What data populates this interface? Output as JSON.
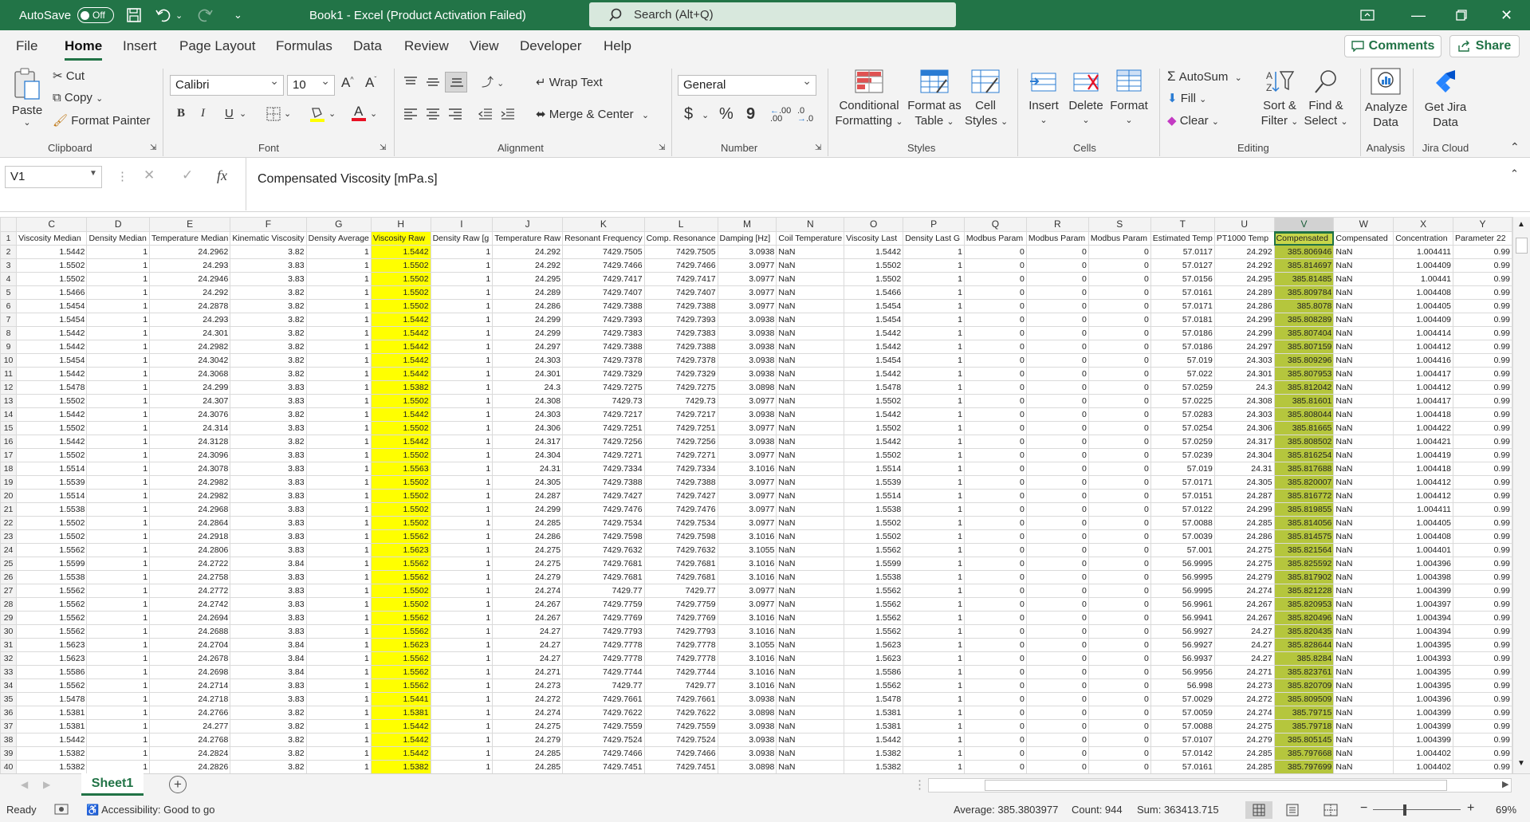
{
  "titlebar": {
    "autosave_label": "AutoSave",
    "autosave_state": "Off",
    "title": "Book1  -  Excel (Product Activation Failed)",
    "search_placeholder": "Search (Alt+Q)"
  },
  "menu": {
    "tabs": [
      "File",
      "Home",
      "Insert",
      "Page Layout",
      "Formulas",
      "Data",
      "Review",
      "View",
      "Developer",
      "Help"
    ],
    "active": "Home",
    "comments_label": "Comments",
    "share_label": "Share"
  },
  "ribbon": {
    "clipboard": {
      "paste": "Paste",
      "cut": "Cut",
      "copy": "Copy",
      "format_painter": "Format Painter",
      "group": "Clipboard"
    },
    "font": {
      "name": "Calibri",
      "size": "10",
      "group": "Font",
      "bold": "B",
      "italic": "I",
      "underline": "U",
      "grow": "A^",
      "shrink": "Aˇ"
    },
    "alignment": {
      "wrap": "Wrap Text",
      "merge": "Merge & Center",
      "group": "Alignment"
    },
    "number": {
      "format": "General",
      "currency": "$",
      "percent": "%",
      "comma": "9",
      "inc_decimal": ".00",
      "dec_decimal": ".0",
      "group": "Number"
    },
    "styles": {
      "conditional_1": "Conditional",
      "conditional_2": "Formatting",
      "format_table_1": "Format as",
      "format_table_2": "Table",
      "cell_styles_1": "Cell",
      "cell_styles_2": "Styles",
      "group": "Styles"
    },
    "cells": {
      "insert": "Insert",
      "delete": "Delete",
      "format": "Format",
      "group": "Cells"
    },
    "editing": {
      "autosum": "AutoSum",
      "fill": "Fill",
      "clear": "Clear",
      "sort_1": "Sort &",
      "sort_2": "Filter",
      "find_1": "Find &",
      "find_2": "Select",
      "group": "Editing"
    },
    "analysis": {
      "analyze_1": "Analyze",
      "analyze_2": "Data",
      "group": "Analysis"
    },
    "jira": {
      "jira_1": "Get Jira",
      "jira_2": "Data",
      "group": "Jira Cloud"
    }
  },
  "formula_bar": {
    "name_box": "V1",
    "content": "Compensated Viscosity [mPa.s]",
    "cancel": "✕",
    "enter": "✓",
    "fx": "fx"
  },
  "grid": {
    "columns": [
      "C",
      "D",
      "E",
      "F",
      "G",
      "H",
      "I",
      "J",
      "K",
      "L",
      "M",
      "N",
      "O",
      "P",
      "Q",
      "R",
      "S",
      "T",
      "U",
      "V",
      "W",
      "X",
      "Y"
    ],
    "selected_column": "V",
    "highlight_column": "H",
    "headers": [
      "Viscosity Median",
      "Density Median",
      "Temperature Median",
      "Kinematic Viscosity",
      "Density Average",
      "Viscosity Raw",
      "Density Raw [g",
      "Temperature Raw",
      "Resonant Frequency",
      "Comp. Resonance",
      "Damping [Hz]",
      "Coil Temperature",
      "Viscosity Last",
      "Density Last G",
      "Modbus Param",
      "Modbus Param",
      "Modbus Param",
      "Estimated Temp",
      "PT1000 Temp",
      "Compensated",
      "Compensated",
      "Concentration",
      "Parameter 22"
    ],
    "rows": [
      [
        "1.5442",
        "1",
        "24.2962",
        "3.82",
        "1",
        "1.5442",
        "1",
        "24.292",
        "7429.7505",
        "7429.7505",
        "3.0938",
        "NaN",
        "1.5442",
        "1",
        "0",
        "0",
        "0",
        "57.0117",
        "24.292",
        "385.806946",
        "NaN",
        "1.004411",
        "0.99"
      ],
      [
        "1.5502",
        "1",
        "24.293",
        "3.83",
        "1",
        "1.5502",
        "1",
        "24.292",
        "7429.7466",
        "7429.7466",
        "3.0977",
        "NaN",
        "1.5502",
        "1",
        "0",
        "0",
        "0",
        "57.0127",
        "24.292",
        "385.814697",
        "NaN",
        "1.004409",
        "0.99"
      ],
      [
        "1.5502",
        "1",
        "24.2946",
        "3.83",
        "1",
        "1.5502",
        "1",
        "24.295",
        "7429.7417",
        "7429.7417",
        "3.0977",
        "NaN",
        "1.5502",
        "1",
        "0",
        "0",
        "0",
        "57.0156",
        "24.295",
        "385.81485",
        "NaN",
        "1.00441",
        "0.99"
      ],
      [
        "1.5466",
        "1",
        "24.292",
        "3.82",
        "1",
        "1.5502",
        "1",
        "24.289",
        "7429.7407",
        "7429.7407",
        "3.0977",
        "NaN",
        "1.5466",
        "1",
        "0",
        "0",
        "0",
        "57.0161",
        "24.289",
        "385.809784",
        "NaN",
        "1.004408",
        "0.99"
      ],
      [
        "1.5454",
        "1",
        "24.2878",
        "3.82",
        "1",
        "1.5502",
        "1",
        "24.286",
        "7429.7388",
        "7429.7388",
        "3.0977",
        "NaN",
        "1.5454",
        "1",
        "0",
        "0",
        "0",
        "57.0171",
        "24.286",
        "385.8078",
        "NaN",
        "1.004405",
        "0.99"
      ],
      [
        "1.5454",
        "1",
        "24.293",
        "3.82",
        "1",
        "1.5442",
        "1",
        "24.299",
        "7429.7393",
        "7429.7393",
        "3.0938",
        "NaN",
        "1.5454",
        "1",
        "0",
        "0",
        "0",
        "57.0181",
        "24.299",
        "385.808289",
        "NaN",
        "1.004409",
        "0.99"
      ],
      [
        "1.5442",
        "1",
        "24.301",
        "3.82",
        "1",
        "1.5442",
        "1",
        "24.299",
        "7429.7383",
        "7429.7383",
        "3.0938",
        "NaN",
        "1.5442",
        "1",
        "0",
        "0",
        "0",
        "57.0186",
        "24.299",
        "385.807404",
        "NaN",
        "1.004414",
        "0.99"
      ],
      [
        "1.5442",
        "1",
        "24.2982",
        "3.82",
        "1",
        "1.5442",
        "1",
        "24.297",
        "7429.7388",
        "7429.7388",
        "3.0938",
        "NaN",
        "1.5442",
        "1",
        "0",
        "0",
        "0",
        "57.0186",
        "24.297",
        "385.807159",
        "NaN",
        "1.004412",
        "0.99"
      ],
      [
        "1.5454",
        "1",
        "24.3042",
        "3.82",
        "1",
        "1.5442",
        "1",
        "24.303",
        "7429.7378",
        "7429.7378",
        "3.0938",
        "NaN",
        "1.5454",
        "1",
        "0",
        "0",
        "0",
        "57.019",
        "24.303",
        "385.809296",
        "NaN",
        "1.004416",
        "0.99"
      ],
      [
        "1.5442",
        "1",
        "24.3068",
        "3.82",
        "1",
        "1.5442",
        "1",
        "24.301",
        "7429.7329",
        "7429.7329",
        "3.0938",
        "NaN",
        "1.5442",
        "1",
        "0",
        "0",
        "0",
        "57.022",
        "24.301",
        "385.807953",
        "NaN",
        "1.004417",
        "0.99"
      ],
      [
        "1.5478",
        "1",
        "24.299",
        "3.83",
        "1",
        "1.5382",
        "1",
        "24.3",
        "7429.7275",
        "7429.7275",
        "3.0898",
        "NaN",
        "1.5478",
        "1",
        "0",
        "0",
        "0",
        "57.0259",
        "24.3",
        "385.812042",
        "NaN",
        "1.004412",
        "0.99"
      ],
      [
        "1.5502",
        "1",
        "24.307",
        "3.83",
        "1",
        "1.5502",
        "1",
        "24.308",
        "7429.73",
        "7429.73",
        "3.0977",
        "NaN",
        "1.5502",
        "1",
        "0",
        "0",
        "0",
        "57.0225",
        "24.308",
        "385.81601",
        "NaN",
        "1.004417",
        "0.99"
      ],
      [
        "1.5442",
        "1",
        "24.3076",
        "3.82",
        "1",
        "1.5442",
        "1",
        "24.303",
        "7429.7217",
        "7429.7217",
        "3.0938",
        "NaN",
        "1.5442",
        "1",
        "0",
        "0",
        "0",
        "57.0283",
        "24.303",
        "385.808044",
        "NaN",
        "1.004418",
        "0.99"
      ],
      [
        "1.5502",
        "1",
        "24.314",
        "3.83",
        "1",
        "1.5502",
        "1",
        "24.306",
        "7429.7251",
        "7429.7251",
        "3.0977",
        "NaN",
        "1.5502",
        "1",
        "0",
        "0",
        "0",
        "57.0254",
        "24.306",
        "385.81665",
        "NaN",
        "1.004422",
        "0.99"
      ],
      [
        "1.5442",
        "1",
        "24.3128",
        "3.82",
        "1",
        "1.5442",
        "1",
        "24.317",
        "7429.7256",
        "7429.7256",
        "3.0938",
        "NaN",
        "1.5442",
        "1",
        "0",
        "0",
        "0",
        "57.0259",
        "24.317",
        "385.808502",
        "NaN",
        "1.004421",
        "0.99"
      ],
      [
        "1.5502",
        "1",
        "24.3096",
        "3.83",
        "1",
        "1.5502",
        "1",
        "24.304",
        "7429.7271",
        "7429.7271",
        "3.0977",
        "NaN",
        "1.5502",
        "1",
        "0",
        "0",
        "0",
        "57.0239",
        "24.304",
        "385.816254",
        "NaN",
        "1.004419",
        "0.99"
      ],
      [
        "1.5514",
        "1",
        "24.3078",
        "3.83",
        "1",
        "1.5563",
        "1",
        "24.31",
        "7429.7334",
        "7429.7334",
        "3.1016",
        "NaN",
        "1.5514",
        "1",
        "0",
        "0",
        "0",
        "57.019",
        "24.31",
        "385.817688",
        "NaN",
        "1.004418",
        "0.99"
      ],
      [
        "1.5539",
        "1",
        "24.2982",
        "3.83",
        "1",
        "1.5502",
        "1",
        "24.305",
        "7429.7388",
        "7429.7388",
        "3.0977",
        "NaN",
        "1.5539",
        "1",
        "0",
        "0",
        "0",
        "57.0171",
        "24.305",
        "385.820007",
        "NaN",
        "1.004412",
        "0.99"
      ],
      [
        "1.5514",
        "1",
        "24.2982",
        "3.83",
        "1",
        "1.5502",
        "1",
        "24.287",
        "7429.7427",
        "7429.7427",
        "3.0977",
        "NaN",
        "1.5514",
        "1",
        "0",
        "0",
        "0",
        "57.0151",
        "24.287",
        "385.816772",
        "NaN",
        "1.004412",
        "0.99"
      ],
      [
        "1.5538",
        "1",
        "24.2968",
        "3.83",
        "1",
        "1.5502",
        "1",
        "24.299",
        "7429.7476",
        "7429.7476",
        "3.0977",
        "NaN",
        "1.5538",
        "1",
        "0",
        "0",
        "0",
        "57.0122",
        "24.299",
        "385.819855",
        "NaN",
        "1.004411",
        "0.99"
      ],
      [
        "1.5502",
        "1",
        "24.2864",
        "3.83",
        "1",
        "1.5502",
        "1",
        "24.285",
        "7429.7534",
        "7429.7534",
        "3.0977",
        "NaN",
        "1.5502",
        "1",
        "0",
        "0",
        "0",
        "57.0088",
        "24.285",
        "385.814056",
        "NaN",
        "1.004405",
        "0.99"
      ],
      [
        "1.5502",
        "1",
        "24.2918",
        "3.83",
        "1",
        "1.5562",
        "1",
        "24.286",
        "7429.7598",
        "7429.7598",
        "3.1016",
        "NaN",
        "1.5502",
        "1",
        "0",
        "0",
        "0",
        "57.0039",
        "24.286",
        "385.814575",
        "NaN",
        "1.004408",
        "0.99"
      ],
      [
        "1.5562",
        "1",
        "24.2806",
        "3.83",
        "1",
        "1.5623",
        "1",
        "24.275",
        "7429.7632",
        "7429.7632",
        "3.1055",
        "NaN",
        "1.5562",
        "1",
        "0",
        "0",
        "0",
        "57.001",
        "24.275",
        "385.821564",
        "NaN",
        "1.004401",
        "0.99"
      ],
      [
        "1.5599",
        "1",
        "24.2722",
        "3.84",
        "1",
        "1.5562",
        "1",
        "24.275",
        "7429.7681",
        "7429.7681",
        "3.1016",
        "NaN",
        "1.5599",
        "1",
        "0",
        "0",
        "0",
        "56.9995",
        "24.275",
        "385.825592",
        "NaN",
        "1.004396",
        "0.99"
      ],
      [
        "1.5538",
        "1",
        "24.2758",
        "3.83",
        "1",
        "1.5562",
        "1",
        "24.279",
        "7429.7681",
        "7429.7681",
        "3.1016",
        "NaN",
        "1.5538",
        "1",
        "0",
        "0",
        "0",
        "56.9995",
        "24.279",
        "385.817902",
        "NaN",
        "1.004398",
        "0.99"
      ],
      [
        "1.5562",
        "1",
        "24.2772",
        "3.83",
        "1",
        "1.5502",
        "1",
        "24.274",
        "7429.77",
        "7429.77",
        "3.0977",
        "NaN",
        "1.5562",
        "1",
        "0",
        "0",
        "0",
        "56.9995",
        "24.274",
        "385.821228",
        "NaN",
        "1.004399",
        "0.99"
      ],
      [
        "1.5562",
        "1",
        "24.2742",
        "3.83",
        "1",
        "1.5502",
        "1",
        "24.267",
        "7429.7759",
        "7429.7759",
        "3.0977",
        "NaN",
        "1.5562",
        "1",
        "0",
        "0",
        "0",
        "56.9961",
        "24.267",
        "385.820953",
        "NaN",
        "1.004397",
        "0.99"
      ],
      [
        "1.5562",
        "1",
        "24.2694",
        "3.83",
        "1",
        "1.5562",
        "1",
        "24.267",
        "7429.7769",
        "7429.7769",
        "3.1016",
        "NaN",
        "1.5562",
        "1",
        "0",
        "0",
        "0",
        "56.9941",
        "24.267",
        "385.820496",
        "NaN",
        "1.004394",
        "0.99"
      ],
      [
        "1.5562",
        "1",
        "24.2688",
        "3.83",
        "1",
        "1.5562",
        "1",
        "24.27",
        "7429.7793",
        "7429.7793",
        "3.1016",
        "NaN",
        "1.5562",
        "1",
        "0",
        "0",
        "0",
        "56.9927",
        "24.27",
        "385.820435",
        "NaN",
        "1.004394",
        "0.99"
      ],
      [
        "1.5623",
        "1",
        "24.2704",
        "3.84",
        "1",
        "1.5623",
        "1",
        "24.27",
        "7429.7778",
        "7429.7778",
        "3.1055",
        "NaN",
        "1.5623",
        "1",
        "0",
        "0",
        "0",
        "56.9927",
        "24.27",
        "385.828644",
        "NaN",
        "1.004395",
        "0.99"
      ],
      [
        "1.5623",
        "1",
        "24.2678",
        "3.84",
        "1",
        "1.5562",
        "1",
        "24.27",
        "7429.7778",
        "7429.7778",
        "3.1016",
        "NaN",
        "1.5623",
        "1",
        "0",
        "0",
        "0",
        "56.9937",
        "24.27",
        "385.8284",
        "NaN",
        "1.004393",
        "0.99"
      ],
      [
        "1.5586",
        "1",
        "24.2698",
        "3.84",
        "1",
        "1.5562",
        "1",
        "24.271",
        "7429.7744",
        "7429.7744",
        "3.1016",
        "NaN",
        "1.5586",
        "1",
        "0",
        "0",
        "0",
        "56.9956",
        "24.271",
        "385.823761",
        "NaN",
        "1.004395",
        "0.99"
      ],
      [
        "1.5562",
        "1",
        "24.2714",
        "3.83",
        "1",
        "1.5562",
        "1",
        "24.273",
        "7429.77",
        "7429.77",
        "3.1016",
        "NaN",
        "1.5562",
        "1",
        "0",
        "0",
        "0",
        "56.998",
        "24.273",
        "385.820709",
        "NaN",
        "1.004395",
        "0.99"
      ],
      [
        "1.5478",
        "1",
        "24.2718",
        "3.83",
        "1",
        "1.5441",
        "1",
        "24.272",
        "7429.7661",
        "7429.7661",
        "3.0938",
        "NaN",
        "1.5478",
        "1",
        "0",
        "0",
        "0",
        "57.0029",
        "24.272",
        "385.809509",
        "NaN",
        "1.004396",
        "0.99"
      ],
      [
        "1.5381",
        "1",
        "24.2766",
        "3.82",
        "1",
        "1.5381",
        "1",
        "24.274",
        "7429.7622",
        "7429.7622",
        "3.0898",
        "NaN",
        "1.5381",
        "1",
        "0",
        "0",
        "0",
        "57.0059",
        "24.274",
        "385.79715",
        "NaN",
        "1.004399",
        "0.99"
      ],
      [
        "1.5381",
        "1",
        "24.277",
        "3.82",
        "1",
        "1.5442",
        "1",
        "24.275",
        "7429.7559",
        "7429.7559",
        "3.0938",
        "NaN",
        "1.5381",
        "1",
        "0",
        "0",
        "0",
        "57.0088",
        "24.275",
        "385.79718",
        "NaN",
        "1.004399",
        "0.99"
      ],
      [
        "1.5442",
        "1",
        "24.2768",
        "3.82",
        "1",
        "1.5442",
        "1",
        "24.279",
        "7429.7524",
        "7429.7524",
        "3.0938",
        "NaN",
        "1.5442",
        "1",
        "0",
        "0",
        "0",
        "57.0107",
        "24.279",
        "385.805145",
        "NaN",
        "1.004399",
        "0.99"
      ],
      [
        "1.5382",
        "1",
        "24.2824",
        "3.82",
        "1",
        "1.5442",
        "1",
        "24.285",
        "7429.7466",
        "7429.7466",
        "3.0938",
        "NaN",
        "1.5382",
        "1",
        "0",
        "0",
        "0",
        "57.0142",
        "24.285",
        "385.797668",
        "NaN",
        "1.004402",
        "0.99"
      ],
      [
        "1.5382",
        "1",
        "24.2826",
        "3.82",
        "1",
        "1.5382",
        "1",
        "24.285",
        "7429.7451",
        "7429.7451",
        "3.0898",
        "NaN",
        "1.5382",
        "1",
        "0",
        "0",
        "0",
        "57.0161",
        "24.285",
        "385.797699",
        "NaN",
        "1.004402",
        "0.99"
      ]
    ]
  },
  "sheets": {
    "active": "Sheet1",
    "add": "+"
  },
  "status": {
    "ready": "Ready",
    "accessibility": "Accessibility: Good to go",
    "average": "Average: 385.3803977",
    "count": "Count: 944",
    "sum": "Sum: 363413.715",
    "zoom": "69%",
    "zoom_minus": "−",
    "zoom_plus": "+"
  },
  "colors": {
    "brand": "#217346",
    "titlebar": "#227447",
    "highlight": "#ffff00",
    "selected": "#b5c63d"
  }
}
